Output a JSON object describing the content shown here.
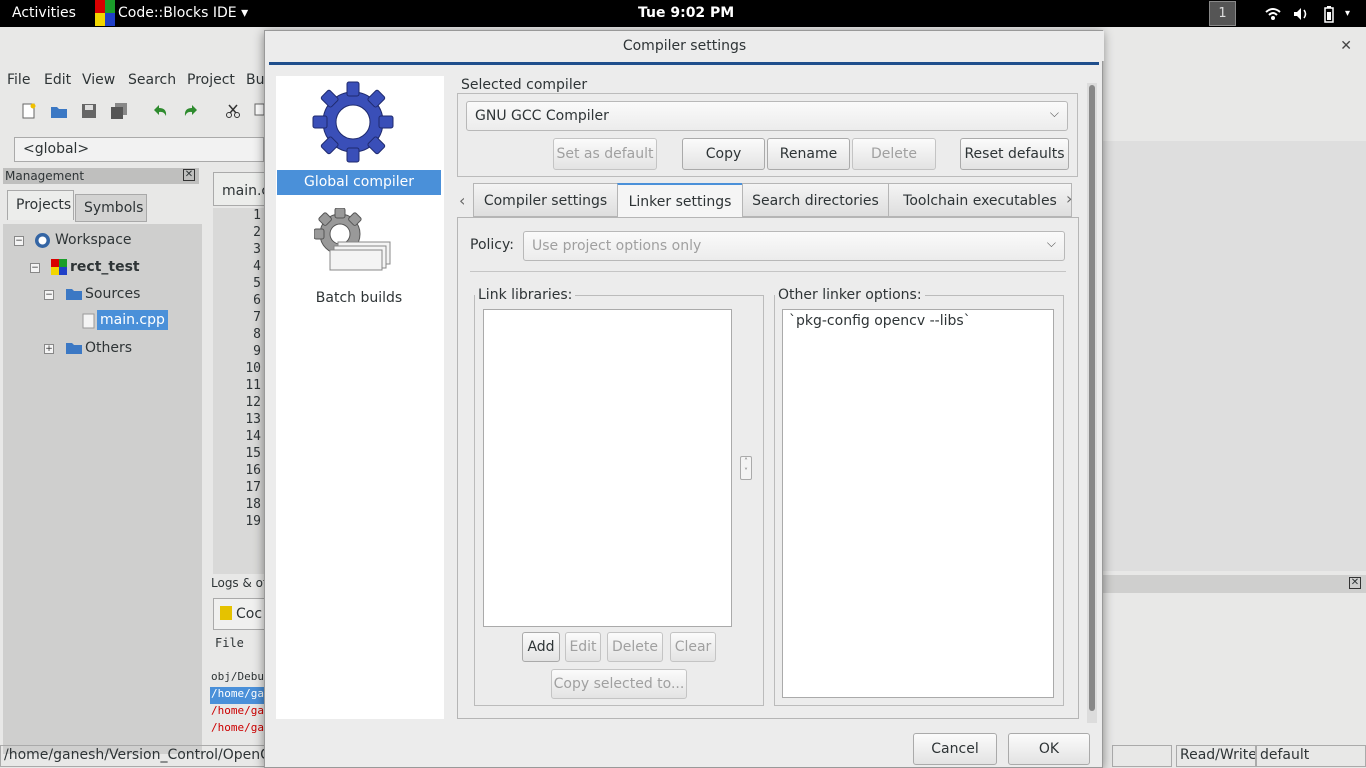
{
  "topbar": {
    "activities": "Activities",
    "app_name": "Code::Blocks IDE ▾",
    "clock": "Tue  9:02 PM",
    "workspace": "1"
  },
  "ide": {
    "menu": [
      "File",
      "Edit",
      "View",
      "Search",
      "Project",
      "Bu"
    ],
    "global_combo": "<global>",
    "management": {
      "header": "Management",
      "tabs": [
        "Projects",
        "Symbols"
      ],
      "tree": {
        "workspace": "Workspace",
        "project": "rect_test",
        "sources": "Sources",
        "file": "main.cpp",
        "others": "Others"
      }
    },
    "editor": {
      "tab": "main.c",
      "line_numbers": [
        "1",
        "2",
        "3",
        "4",
        "5",
        "6",
        "7",
        "8",
        "9",
        "10",
        "11",
        "12",
        "13",
        "14",
        "15",
        "16",
        "17",
        "18",
        "19"
      ]
    },
    "logs": {
      "header": "Logs & ot",
      "tab": "Coc",
      "col": "File",
      "lines": [
        "obj/Debug",
        "/home/gan",
        "/home/gan",
        "/home/gan"
      ]
    },
    "status": {
      "path": "/home/ganesh/Version_Control/OpenCV",
      "mode": "Read/Write",
      "profile": "default"
    }
  },
  "dialog": {
    "title": "Compiler settings",
    "left_items": [
      "Global compiler settings",
      "Batch builds"
    ],
    "selected_compiler_label": "Selected compiler",
    "selected_compiler": "GNU GCC Compiler",
    "compiler_buttons": {
      "set_default": "Set as default",
      "copy": "Copy",
      "rename": "Rename",
      "delete": "Delete",
      "reset": "Reset defaults"
    },
    "tabs": [
      "Compiler settings",
      "Linker settings",
      "Search directories",
      "Toolchain executables"
    ],
    "active_tab": "Linker settings",
    "policy_label": "Policy:",
    "policy_value": "Use project options only",
    "link_libraries_label": "Link libraries:",
    "link_buttons": {
      "add": "Add",
      "edit": "Edit",
      "delete": "Delete",
      "clear": "Clear",
      "copy_to": "Copy selected to..."
    },
    "other_linker_label": "Other linker options:",
    "other_linker_value": "`pkg-config opencv --libs`",
    "cancel": "Cancel",
    "ok": "OK"
  },
  "colors": {
    "accent": "#4a90d9",
    "dialog_rule": "#1f4e8c",
    "log_error": "#cc0000"
  }
}
